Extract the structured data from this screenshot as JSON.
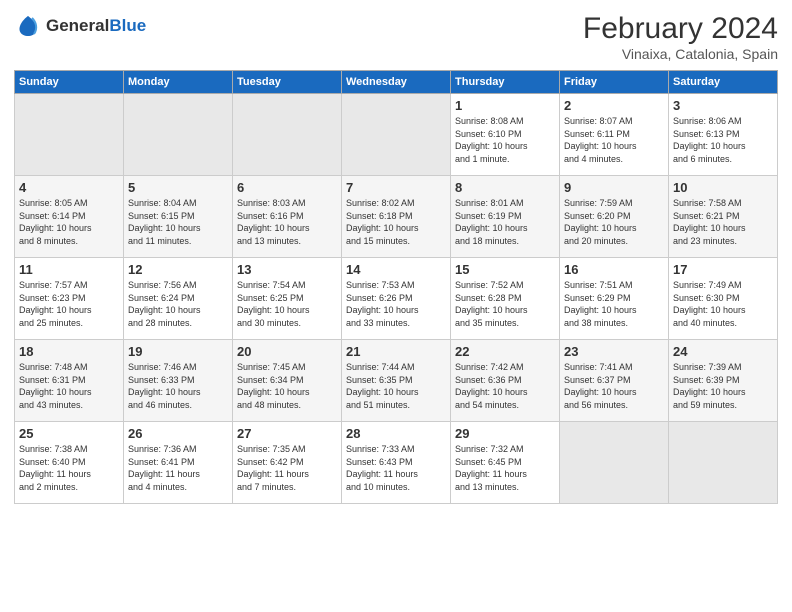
{
  "header": {
    "logo_general": "General",
    "logo_blue": "Blue",
    "main_title": "February 2024",
    "subtitle": "Vinaixa, Catalonia, Spain"
  },
  "days_of_week": [
    "Sunday",
    "Monday",
    "Tuesday",
    "Wednesday",
    "Thursday",
    "Friday",
    "Saturday"
  ],
  "weeks": [
    {
      "days": [
        {
          "num": "",
          "info": "",
          "empty": true
        },
        {
          "num": "",
          "info": "",
          "empty": true
        },
        {
          "num": "",
          "info": "",
          "empty": true
        },
        {
          "num": "",
          "info": "",
          "empty": true
        },
        {
          "num": "1",
          "info": "Sunrise: 8:08 AM\nSunset: 6:10 PM\nDaylight: 10 hours\nand 1 minute.",
          "empty": false
        },
        {
          "num": "2",
          "info": "Sunrise: 8:07 AM\nSunset: 6:11 PM\nDaylight: 10 hours\nand 4 minutes.",
          "empty": false
        },
        {
          "num": "3",
          "info": "Sunrise: 8:06 AM\nSunset: 6:13 PM\nDaylight: 10 hours\nand 6 minutes.",
          "empty": false
        }
      ]
    },
    {
      "days": [
        {
          "num": "4",
          "info": "Sunrise: 8:05 AM\nSunset: 6:14 PM\nDaylight: 10 hours\nand 8 minutes.",
          "empty": false
        },
        {
          "num": "5",
          "info": "Sunrise: 8:04 AM\nSunset: 6:15 PM\nDaylight: 10 hours\nand 11 minutes.",
          "empty": false
        },
        {
          "num": "6",
          "info": "Sunrise: 8:03 AM\nSunset: 6:16 PM\nDaylight: 10 hours\nand 13 minutes.",
          "empty": false
        },
        {
          "num": "7",
          "info": "Sunrise: 8:02 AM\nSunset: 6:18 PM\nDaylight: 10 hours\nand 15 minutes.",
          "empty": false
        },
        {
          "num": "8",
          "info": "Sunrise: 8:01 AM\nSunset: 6:19 PM\nDaylight: 10 hours\nand 18 minutes.",
          "empty": false
        },
        {
          "num": "9",
          "info": "Sunrise: 7:59 AM\nSunset: 6:20 PM\nDaylight: 10 hours\nand 20 minutes.",
          "empty": false
        },
        {
          "num": "10",
          "info": "Sunrise: 7:58 AM\nSunset: 6:21 PM\nDaylight: 10 hours\nand 23 minutes.",
          "empty": false
        }
      ]
    },
    {
      "days": [
        {
          "num": "11",
          "info": "Sunrise: 7:57 AM\nSunset: 6:23 PM\nDaylight: 10 hours\nand 25 minutes.",
          "empty": false
        },
        {
          "num": "12",
          "info": "Sunrise: 7:56 AM\nSunset: 6:24 PM\nDaylight: 10 hours\nand 28 minutes.",
          "empty": false
        },
        {
          "num": "13",
          "info": "Sunrise: 7:54 AM\nSunset: 6:25 PM\nDaylight: 10 hours\nand 30 minutes.",
          "empty": false
        },
        {
          "num": "14",
          "info": "Sunrise: 7:53 AM\nSunset: 6:26 PM\nDaylight: 10 hours\nand 33 minutes.",
          "empty": false
        },
        {
          "num": "15",
          "info": "Sunrise: 7:52 AM\nSunset: 6:28 PM\nDaylight: 10 hours\nand 35 minutes.",
          "empty": false
        },
        {
          "num": "16",
          "info": "Sunrise: 7:51 AM\nSunset: 6:29 PM\nDaylight: 10 hours\nand 38 minutes.",
          "empty": false
        },
        {
          "num": "17",
          "info": "Sunrise: 7:49 AM\nSunset: 6:30 PM\nDaylight: 10 hours\nand 40 minutes.",
          "empty": false
        }
      ]
    },
    {
      "days": [
        {
          "num": "18",
          "info": "Sunrise: 7:48 AM\nSunset: 6:31 PM\nDaylight: 10 hours\nand 43 minutes.",
          "empty": false
        },
        {
          "num": "19",
          "info": "Sunrise: 7:46 AM\nSunset: 6:33 PM\nDaylight: 10 hours\nand 46 minutes.",
          "empty": false
        },
        {
          "num": "20",
          "info": "Sunrise: 7:45 AM\nSunset: 6:34 PM\nDaylight: 10 hours\nand 48 minutes.",
          "empty": false
        },
        {
          "num": "21",
          "info": "Sunrise: 7:44 AM\nSunset: 6:35 PM\nDaylight: 10 hours\nand 51 minutes.",
          "empty": false
        },
        {
          "num": "22",
          "info": "Sunrise: 7:42 AM\nSunset: 6:36 PM\nDaylight: 10 hours\nand 54 minutes.",
          "empty": false
        },
        {
          "num": "23",
          "info": "Sunrise: 7:41 AM\nSunset: 6:37 PM\nDaylight: 10 hours\nand 56 minutes.",
          "empty": false
        },
        {
          "num": "24",
          "info": "Sunrise: 7:39 AM\nSunset: 6:39 PM\nDaylight: 10 hours\nand 59 minutes.",
          "empty": false
        }
      ]
    },
    {
      "days": [
        {
          "num": "25",
          "info": "Sunrise: 7:38 AM\nSunset: 6:40 PM\nDaylight: 11 hours\nand 2 minutes.",
          "empty": false
        },
        {
          "num": "26",
          "info": "Sunrise: 7:36 AM\nSunset: 6:41 PM\nDaylight: 11 hours\nand 4 minutes.",
          "empty": false
        },
        {
          "num": "27",
          "info": "Sunrise: 7:35 AM\nSunset: 6:42 PM\nDaylight: 11 hours\nand 7 minutes.",
          "empty": false
        },
        {
          "num": "28",
          "info": "Sunrise: 7:33 AM\nSunset: 6:43 PM\nDaylight: 11 hours\nand 10 minutes.",
          "empty": false
        },
        {
          "num": "29",
          "info": "Sunrise: 7:32 AM\nSunset: 6:45 PM\nDaylight: 11 hours\nand 13 minutes.",
          "empty": false
        },
        {
          "num": "",
          "info": "",
          "empty": true
        },
        {
          "num": "",
          "info": "",
          "empty": true
        }
      ]
    }
  ]
}
